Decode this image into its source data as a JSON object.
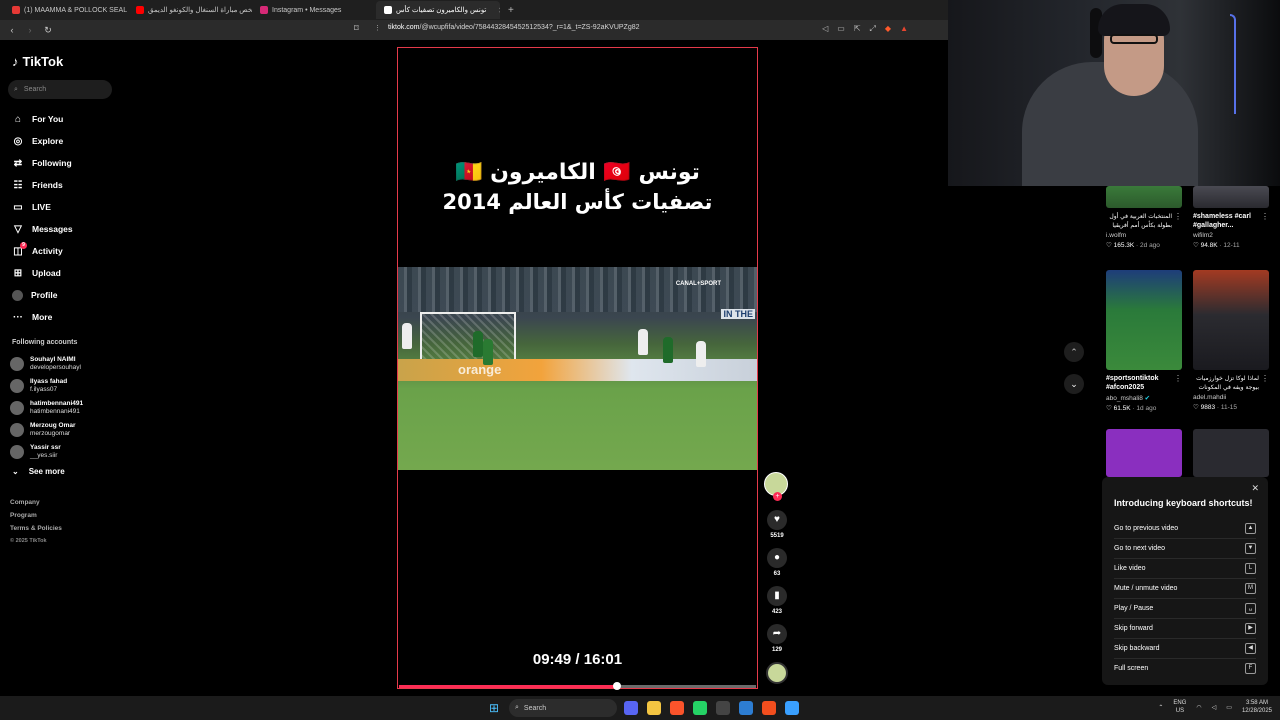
{
  "browser": {
    "tabs": [
      {
        "title": "(1) MAAMMA & POLLOCK SEAL LEIC",
        "color": "#e53935",
        "active": false
      },
      {
        "title": "ملخص مباراة السنغال والكونغو الديمق",
        "color": "#ff0000",
        "active": false
      },
      {
        "title": "Instagram • Messages",
        "color": "#d62976",
        "active": false
      },
      {
        "title": "تونس والكاميرون تصفيات كأس",
        "color": "#ffffff",
        "active": true
      }
    ],
    "url_host": "tiktok.com",
    "url_path": "/@wcupfifa/video/7584432845452512534?_r=1&_t=ZS-92aKVUPZg82",
    "icons": [
      "back-icon",
      "forward-icon",
      "reload-icon",
      "bookmark-icon"
    ]
  },
  "sidebar": {
    "logo_text": "TikTok",
    "search_placeholder": "Search",
    "nav": [
      {
        "label": "For You",
        "icon": "⌂"
      },
      {
        "label": "Explore",
        "icon": "◎"
      },
      {
        "label": "Following",
        "icon": "⇄"
      },
      {
        "label": "Friends",
        "icon": "☷"
      },
      {
        "label": "LIVE",
        "icon": "▭"
      },
      {
        "label": "Messages",
        "icon": "▽"
      },
      {
        "label": "Activity",
        "icon": "◫",
        "badge": "9"
      },
      {
        "label": "Upload",
        "icon": "⊞"
      },
      {
        "label": "Profile",
        "icon": "●"
      },
      {
        "label": "More",
        "icon": "···"
      }
    ],
    "following_title": "Following accounts",
    "accounts": [
      {
        "name": "Souhayl NAIMI",
        "user": "developersouhayl"
      },
      {
        "name": "Ilyass fahad",
        "user": "f.ilyass07"
      },
      {
        "name": "hatimbennani491",
        "user": "hatimbennani491"
      },
      {
        "name": "Merzoug Omar",
        "user": "merzougomar"
      },
      {
        "name": "Yassir ssr",
        "user": "__yes.siir"
      }
    ],
    "see_more": "See more",
    "footer": [
      "Company",
      "Program",
      "Terms & Policies"
    ],
    "copyright": "© 2025 TikTok"
  },
  "video": {
    "title_line1": "تونس 🇹🇳 الكاميرون 🇨🇲",
    "title_line2": "تصفيات كأس العالم 2014",
    "broadcaster": "CANAL+SPORT",
    "board_text": "orange",
    "overlay_word": "IN THE",
    "time": "09:49 / 16:01",
    "progress_percent": 61
  },
  "actions": {
    "likes": "5519",
    "comments": "63",
    "saves": "423",
    "shares": "129"
  },
  "right_column": [
    {
      "caption": "المنتخبات العربية في أول بطولة بكأس أمم أفريقيا",
      "arabic": true,
      "user": "i.wolfm",
      "verified": false,
      "views": "165.3K",
      "date": "2d ago"
    },
    {
      "caption": "#shameless #carl #gallagher...",
      "arabic": false,
      "user": "wifilm2",
      "verified": false,
      "views": "94.8K",
      "date": "12-11"
    },
    {
      "caption": "#sportsontiktok #afcon2025",
      "arabic": false,
      "user": "abo_mshali8",
      "verified": true,
      "views": "61.5K",
      "date": "1d ago"
    },
    {
      "caption": "لماذا لوكا تزل خوارزميات بيوجة ويفه في المكونات",
      "arabic": true,
      "user": "adel.mahdii",
      "verified": false,
      "views": "9883",
      "date": "11-15"
    }
  ],
  "shortcuts": {
    "title": "Introducing keyboard shortcuts!",
    "items": [
      {
        "label": "Go to previous video",
        "key": "▲"
      },
      {
        "label": "Go to next video",
        "key": "▼"
      },
      {
        "label": "Like video",
        "key": "L"
      },
      {
        "label": "Mute / unmute video",
        "key": "M"
      },
      {
        "label": "Play / Pause",
        "key": "␣"
      },
      {
        "label": "Skip forward",
        "key": "▶"
      },
      {
        "label": "Skip backward",
        "key": "◀"
      },
      {
        "label": "Full screen",
        "key": "F"
      }
    ]
  },
  "taskbar": {
    "search": "Search",
    "lang_top": "ENG",
    "lang_bottom": "US",
    "time": "3:58 AM",
    "date": "12/28/2025",
    "app_colors": [
      "#5865f2",
      "#f4c542",
      "#fb542b",
      "#25d366",
      "#444444",
      "#2d7dd2",
      "#f24e1e",
      "#3aa0ff"
    ]
  },
  "colors": {
    "accent": "#fe2c55",
    "video_border": "#e53a4a"
  }
}
